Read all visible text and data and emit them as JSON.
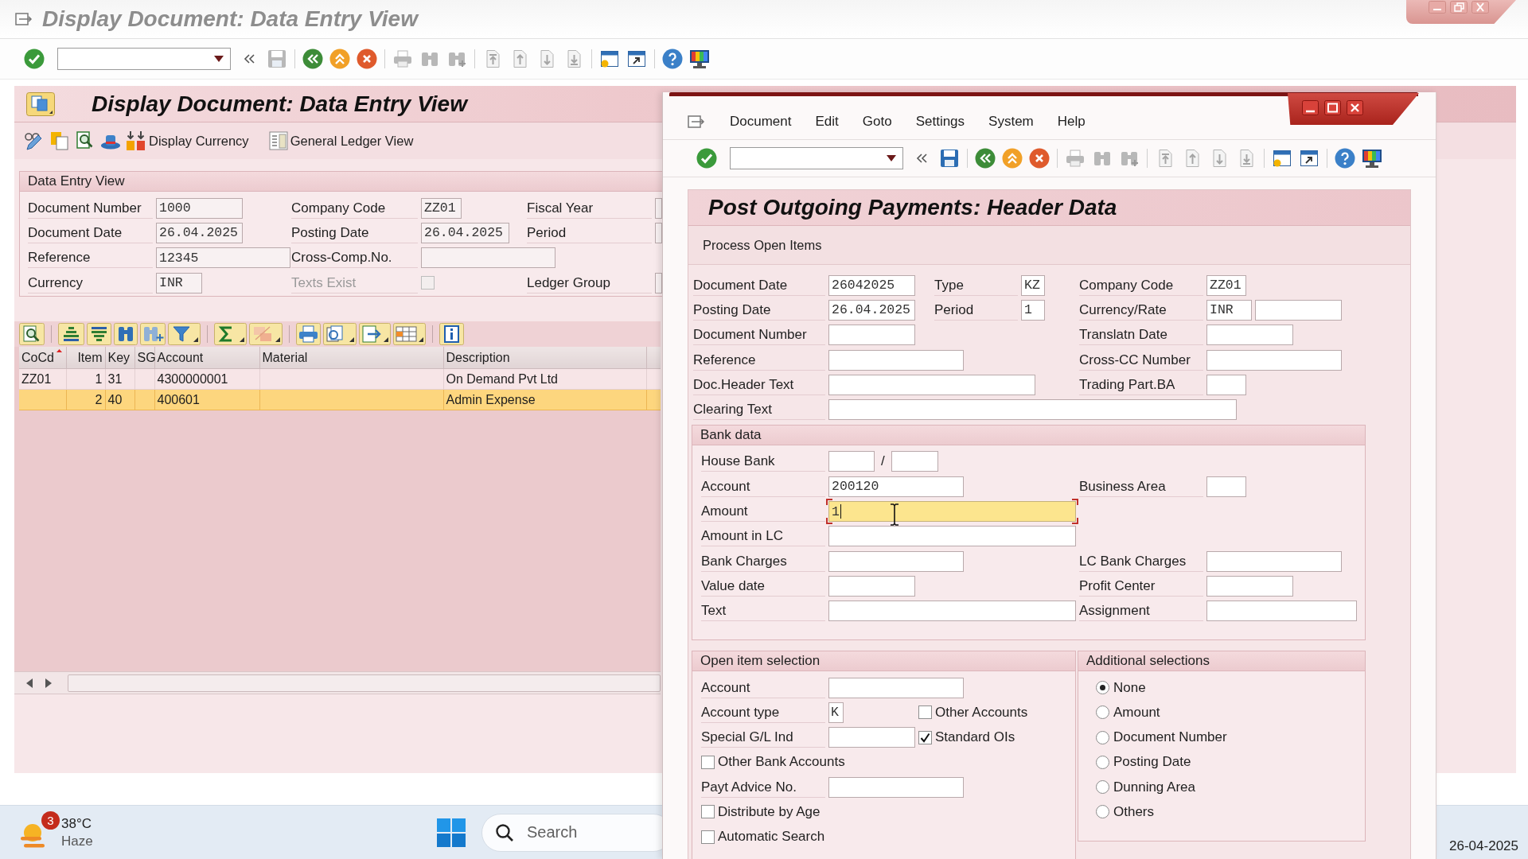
{
  "main_window": {
    "title": "Display Document: Data Entry View",
    "screen_title": "Display Document: Data Entry View",
    "app_toolbar": {
      "buttons": [
        "Display Currency",
        "General Ledger View"
      ]
    },
    "data_entry_view": {
      "title": "Data Entry View",
      "rows": [
        [
          {
            "kind": "input",
            "label": "Document Number",
            "value": "1000",
            "disabled": false
          },
          {
            "kind": "input",
            "label": "Company Code",
            "value": "ZZ01",
            "disabled": false
          },
          {
            "kind": "input",
            "label": "Fiscal Year",
            "disabled": false
          }
        ],
        [
          {
            "kind": "input",
            "label": "Document Date",
            "value": "26.04.2025",
            "disabled": false
          },
          {
            "kind": "input",
            "label": "Posting Date",
            "value": "26.04.2025",
            "disabled": false
          },
          {
            "kind": "input",
            "label": "Period",
            "disabled": false
          }
        ],
        [
          {
            "kind": "input",
            "label": "Reference",
            "value": "12345",
            "disabled": false
          },
          {
            "kind": "input",
            "label": "Cross-Comp.No.",
            "disabled": false
          }
        ],
        [
          {
            "kind": "input",
            "label": "Currency",
            "value": "INR",
            "disabled": false
          },
          {
            "kind": "checkbox",
            "label": "Texts Exist",
            "checked": false,
            "disabled": true
          },
          {
            "kind": "input",
            "label": "Ledger Group",
            "disabled": false
          }
        ]
      ]
    },
    "table": {
      "columns": [
        {
          "label": "CoCd",
          "sorted": true
        },
        {
          "label": "Item",
          "sorted": false
        },
        {
          "label": "Key",
          "sorted": false
        },
        {
          "label": "SG",
          "sorted": false
        },
        {
          "label": "Account",
          "sorted": false
        },
        {
          "label": "Material",
          "sorted": false
        },
        {
          "label": "Description",
          "sorted": false
        }
      ],
      "rows": [
        {
          "selected": false,
          "cells": [
            "ZZ01",
            "1",
            "31",
            null,
            "4300000001",
            null,
            "On Demand Pvt Ltd"
          ]
        },
        {
          "selected": true,
          "cells": [
            null,
            "2",
            "40",
            null,
            "400601",
            null,
            "Admin Expense"
          ]
        }
      ]
    }
  },
  "dialog": {
    "menu": [
      "Document",
      "Edit",
      "Goto",
      "Settings",
      "System",
      "Help"
    ],
    "screen_title": "Post Outgoing Payments: Header Data",
    "app_toolbar": {
      "buttons": [
        "Process Open Items"
      ]
    },
    "header_fields": [
      {
        "kind": "input",
        "label": "Document Date",
        "value": "26042025"
      },
      {
        "kind": "input",
        "label": "Type",
        "value": "KZ"
      },
      {
        "kind": "input",
        "label": "Company Code",
        "value": "ZZ01"
      },
      {
        "kind": "input",
        "label": "Posting Date",
        "value": "26.04.2025"
      },
      {
        "kind": "input",
        "label": "Period",
        "value": "1"
      },
      {
        "kind": "pair",
        "label": "Currency/Rate",
        "value": "INR"
      },
      {
        "kind": "input",
        "label": "Document Number"
      },
      {
        "kind": "input",
        "label": "Translatn Date"
      },
      {
        "kind": "input",
        "label": "Reference"
      },
      {
        "kind": "input",
        "label": "Cross-CC Number"
      },
      {
        "kind": "input",
        "label": "Doc.Header Text"
      },
      {
        "kind": "input",
        "label": "Trading Part.BA"
      },
      {
        "kind": "input",
        "label": "Clearing Text"
      }
    ],
    "bank_data": {
      "title": "Bank data",
      "fields": [
        {
          "kind": "pair",
          "label": "House Bank",
          "separator": "/",
          "focused": false
        },
        {
          "kind": "input",
          "label": "Account",
          "value": "200120",
          "focused": false
        },
        {
          "kind": "input",
          "label": "Business Area",
          "focused": false
        },
        {
          "kind": "input",
          "label": "Amount",
          "value": "1",
          "focused": true
        },
        {
          "kind": "input",
          "label": "Amount in LC",
          "focused": false
        },
        {
          "kind": "input",
          "label": "Bank Charges",
          "focused": false
        },
        {
          "kind": "input",
          "label": "LC Bank Charges",
          "focused": false
        },
        {
          "kind": "input",
          "label": "Value date",
          "focused": false
        },
        {
          "kind": "input",
          "label": "Profit Center",
          "focused": false
        },
        {
          "kind": "input",
          "label": "Text",
          "focused": false
        },
        {
          "kind": "input",
          "label": "Assignment",
          "focused": false
        }
      ]
    },
    "open_item_selection": {
      "title": "Open item selection",
      "fields": [
        {
          "kind": "input",
          "label": "Account"
        },
        {
          "kind": "input",
          "label": "Account type",
          "value": "K"
        },
        {
          "kind": "checkbox",
          "label": "Other Accounts",
          "checked": false
        },
        {
          "kind": "input",
          "label": "Special G/L Ind"
        },
        {
          "kind": "checkbox",
          "label": "Standard OIs",
          "checked": true
        },
        {
          "kind": "checkbox",
          "label": "Other Bank Accounts",
          "checked": false
        },
        {
          "kind": "input",
          "label": "Payt Advice No."
        },
        {
          "kind": "checkbox",
          "label": "Distribute by Age",
          "checked": false
        },
        {
          "kind": "checkbox",
          "label": "Automatic Search",
          "checked": false
        }
      ]
    },
    "additional_selections": {
      "title": "Additional selections",
      "options": [
        {
          "label": "None",
          "selected": true
        },
        {
          "label": "Amount",
          "selected": false
        },
        {
          "label": "Document Number",
          "selected": false
        },
        {
          "label": "Posting Date",
          "selected": false
        },
        {
          "label": "Dunning Area",
          "selected": false
        },
        {
          "label": "Others",
          "selected": false
        }
      ]
    }
  },
  "taskbar": {
    "weather": {
      "badge": "3",
      "temperature": "38°C",
      "condition": "Haze"
    },
    "search": {
      "placeholder": "Search"
    },
    "clock": {
      "date": "26-04-2025"
    }
  }
}
